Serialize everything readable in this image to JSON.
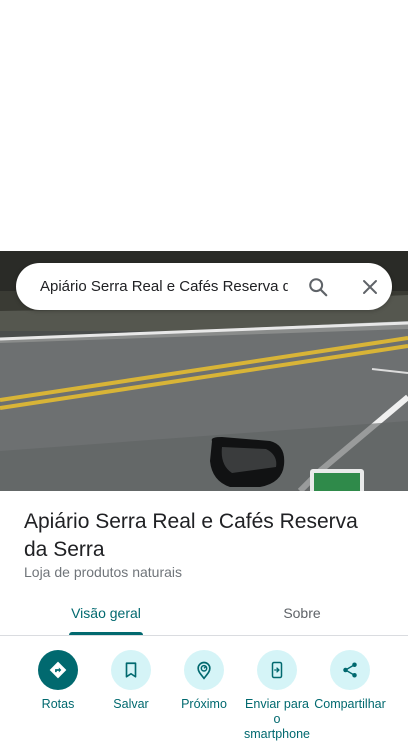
{
  "search": {
    "query": "Apiário Serra Real e Cafés Reserva da Serra"
  },
  "place": {
    "title": "Apiário Serra Real e Cafés Reserva da Serra",
    "category": "Loja de produtos naturais"
  },
  "tabs": [
    {
      "label": "Visão geral",
      "selected": true
    },
    {
      "label": "Sobre",
      "selected": false
    }
  ],
  "actions": [
    {
      "label": "Rotas",
      "icon": "directions-icon"
    },
    {
      "label": "Salvar",
      "icon": "bookmark-icon"
    },
    {
      "label": "Próximo",
      "icon": "nearby-icon"
    },
    {
      "label": "Enviar para o smartphone",
      "icon": "send-to-phone-icon"
    },
    {
      "label": "Compartilhar",
      "icon": "share-icon"
    }
  ],
  "colors": {
    "accent": "#01696f",
    "action_bg": "#d5f4f7",
    "text_primary": "#202124",
    "text_secondary": "#70757a"
  }
}
